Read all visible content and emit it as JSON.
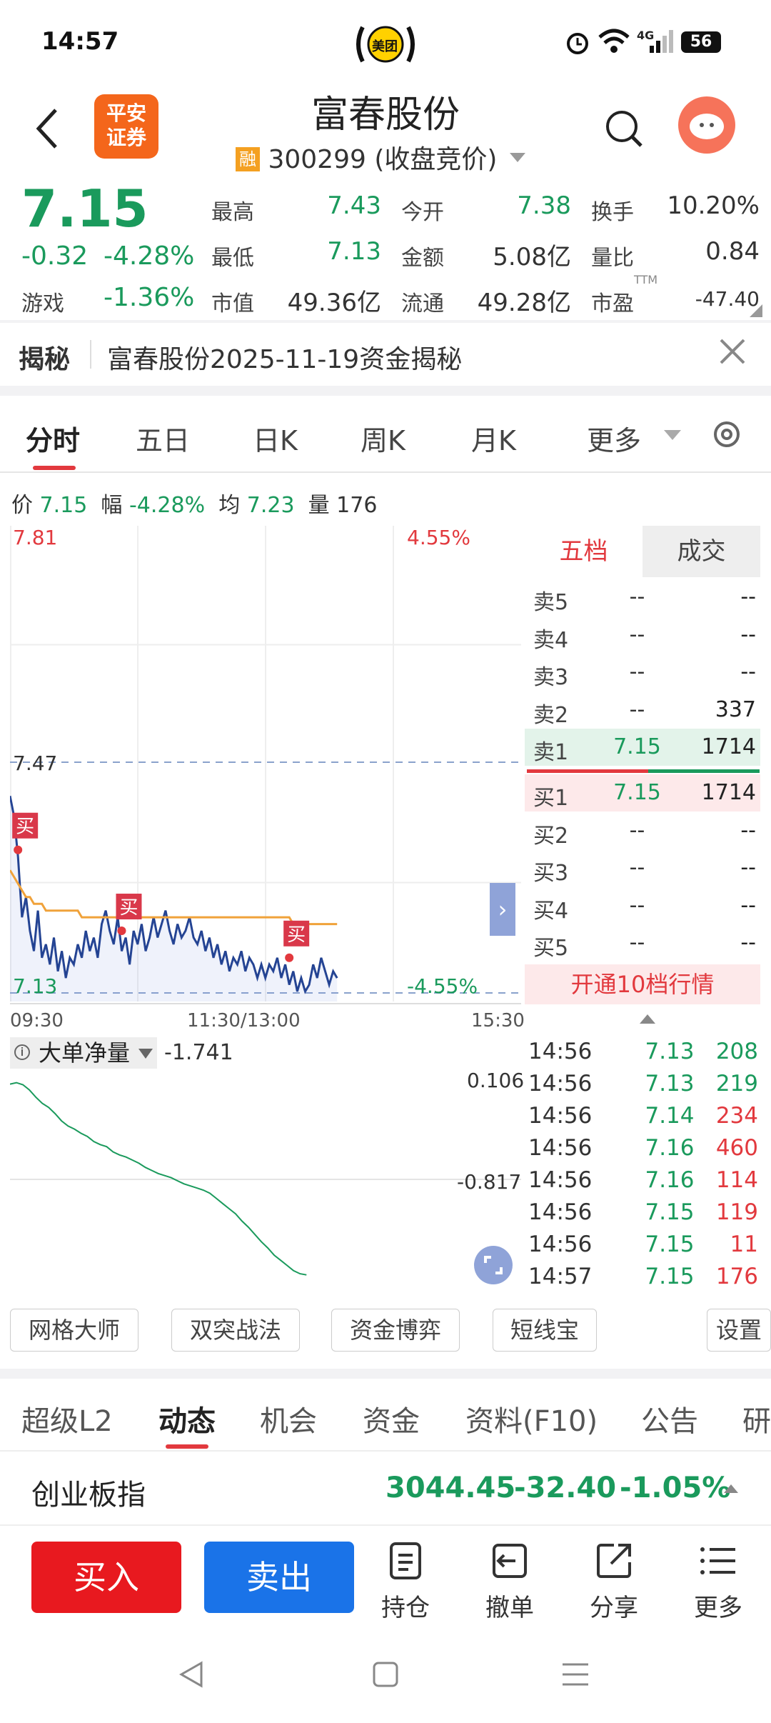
{
  "status_bar": {
    "time": "14:57",
    "center_app": "美团",
    "net": "4G",
    "battery": "56"
  },
  "header": {
    "broker_logo": "平安证券",
    "title": "富春股份",
    "margin_tag": "融",
    "code_line": "300299 (收盘竞价)"
  },
  "quote": {
    "price": "7.15",
    "change": "-0.32",
    "change_pct": "-4.28%",
    "sector_name": "游戏",
    "sector_pct": "-1.36%",
    "cells": [
      {
        "label": "最高",
        "value": "7.43"
      },
      {
        "label": "今开",
        "value": "7.38"
      },
      {
        "label": "换手",
        "value": "10.20%"
      },
      {
        "label": "最低",
        "value": "7.13"
      },
      {
        "label": "金额",
        "value": "5.08亿"
      },
      {
        "label": "量比",
        "value": "0.84"
      },
      {
        "label": "市值",
        "value": "49.36亿"
      },
      {
        "label": "流通",
        "value": "49.28亿"
      },
      {
        "label": "市盈",
        "sup": "TTM",
        "value": "-47.40"
      }
    ]
  },
  "banner": {
    "tag": "揭秘",
    "text": "富春股份2025-11-19资金揭秘"
  },
  "chart_tabs": [
    "分时",
    "五日",
    "日K",
    "周K",
    "月K",
    "更多"
  ],
  "info_line": {
    "price_label": "价",
    "price": "7.15",
    "amp_label": "幅",
    "amp": "-4.28%",
    "avg_label": "均",
    "avg": "7.23",
    "vol_label": "量",
    "vol": "176"
  },
  "chart_data": {
    "type": "line",
    "y_top_label": "7.81",
    "y_top_pct": "4.55%",
    "y_mid_label": "7.47",
    "y_bottom_label": "7.13",
    "y_bottom_pct": "-4.55%",
    "x_labels": [
      "09:30",
      "11:30/13:00",
      "15:30"
    ],
    "buy_marker": "买",
    "price": [
      7.42,
      7.39,
      7.33,
      7.24,
      7.27,
      7.22,
      7.19,
      7.25,
      7.18,
      7.2,
      7.17,
      7.21,
      7.16,
      7.19,
      7.15,
      7.18,
      7.17,
      7.2,
      7.18,
      7.22,
      7.19,
      7.21,
      7.18,
      7.23,
      7.25,
      7.22,
      7.2,
      7.24,
      7.19,
      7.21,
      7.17,
      7.22,
      7.2,
      7.23,
      7.19,
      7.21,
      7.24,
      7.21,
      7.23,
      7.25,
      7.22,
      7.2,
      7.23,
      7.21,
      7.22,
      7.24,
      7.21,
      7.2,
      7.22,
      7.19,
      7.21,
      7.18,
      7.2,
      7.17,
      7.19,
      7.16,
      7.18,
      7.17,
      7.19,
      7.16,
      7.18,
      7.17,
      7.15,
      7.17,
      7.15,
      7.17,
      7.16,
      7.18,
      7.15,
      7.17,
      7.14,
      7.16,
      7.13,
      7.15,
      7.13,
      7.14,
      7.17,
      7.15,
      7.18,
      7.16,
      7.14,
      7.16,
      7.15
    ],
    "avg": [
      7.31,
      7.3,
      7.29,
      7.28,
      7.27,
      7.27,
      7.26,
      7.26,
      7.26,
      7.25,
      7.25,
      7.25,
      7.25,
      7.25,
      7.25,
      7.25,
      7.25,
      7.25,
      7.24,
      7.24,
      7.24,
      7.24,
      7.24,
      7.24,
      7.24,
      7.24,
      7.24,
      7.24,
      7.24,
      7.24,
      7.24,
      7.24,
      7.24,
      7.24,
      7.24,
      7.24,
      7.24,
      7.24,
      7.24,
      7.24,
      7.24,
      7.24,
      7.24,
      7.24,
      7.24,
      7.24,
      7.24,
      7.24,
      7.24,
      7.24,
      7.24,
      7.24,
      7.24,
      7.24,
      7.24,
      7.24,
      7.24,
      7.24,
      7.24,
      7.24,
      7.24,
      7.24,
      7.24,
      7.24,
      7.24,
      7.24,
      7.24,
      7.24,
      7.24,
      7.24,
      7.24,
      7.23,
      7.23,
      7.23,
      7.23,
      7.23,
      7.23,
      7.23,
      7.23,
      7.23,
      7.23,
      7.23,
      7.23
    ],
    "ylim": [
      7.13,
      7.81
    ]
  },
  "orderbook": {
    "tabs": [
      "五档",
      "成交"
    ],
    "asks": [
      {
        "n": "卖5",
        "p": "--",
        "v": "--"
      },
      {
        "n": "卖4",
        "p": "--",
        "v": "--"
      },
      {
        "n": "卖3",
        "p": "--",
        "v": "--"
      },
      {
        "n": "卖2",
        "p": "--",
        "v": "337"
      },
      {
        "n": "卖1",
        "p": "7.15",
        "v": "1714"
      }
    ],
    "bids": [
      {
        "n": "买1",
        "p": "7.15",
        "v": "1714"
      },
      {
        "n": "买2",
        "p": "--",
        "v": "--"
      },
      {
        "n": "买3",
        "p": "--",
        "v": "--"
      },
      {
        "n": "买4",
        "p": "--",
        "v": "--"
      },
      {
        "n": "买5",
        "p": "--",
        "v": "--"
      }
    ],
    "upgrade": "开通10档行情"
  },
  "indicator": {
    "name": "大单净量",
    "value": "-1.741",
    "top": "0.106",
    "mid": "-0.817",
    "series": [
      0.106,
      0.12,
      0.1,
      0.05,
      -0.02,
      -0.08,
      -0.12,
      -0.18,
      -0.25,
      -0.3,
      -0.33,
      -0.37,
      -0.4,
      -0.45,
      -0.48,
      -0.5,
      -0.55,
      -0.58,
      -0.6,
      -0.63,
      -0.66,
      -0.7,
      -0.73,
      -0.76,
      -0.78,
      -0.8,
      -0.83,
      -0.86,
      -0.88,
      -0.9,
      -0.92,
      -0.95,
      -1.0,
      -1.05,
      -1.1,
      -1.15,
      -1.22,
      -1.28,
      -1.35,
      -1.42,
      -1.48,
      -1.55,
      -1.6,
      -1.65,
      -1.7,
      -1.73,
      -1.741
    ]
  },
  "trades": [
    {
      "t": "14:56",
      "p": "7.13",
      "v": "208",
      "c": "g"
    },
    {
      "t": "14:56",
      "p": "7.13",
      "v": "219",
      "c": "g"
    },
    {
      "t": "14:56",
      "p": "7.14",
      "v": "234",
      "c": "r"
    },
    {
      "t": "14:56",
      "p": "7.16",
      "v": "460",
      "c": "r"
    },
    {
      "t": "14:56",
      "p": "7.16",
      "v": "114",
      "c": "r"
    },
    {
      "t": "14:56",
      "p": "7.15",
      "v": "119",
      "c": "r"
    },
    {
      "t": "14:56",
      "p": "7.15",
      "v": "11",
      "c": "r"
    },
    {
      "t": "14:57",
      "p": "7.15",
      "v": "176",
      "c": "r"
    }
  ],
  "tools": [
    "网格大师",
    "双突战法",
    "资金博弈",
    "短线宝",
    "设置"
  ],
  "bottom_tabs": [
    "超级L2",
    "动态",
    "机会",
    "资金",
    "资料(F10)",
    "公告",
    "研"
  ],
  "index": {
    "name": "创业板指",
    "value": "3044.45",
    "change": "-32.40",
    "pct": "-1.05%"
  },
  "actions": {
    "buy": "买入",
    "sell": "卖出",
    "hold": "持仓",
    "cancel": "撤单",
    "share": "分享",
    "more": "更多"
  },
  "colors": {
    "up": "#e2393e",
    "down": "#1a9a5c",
    "buy_btn": "#e8191f",
    "sell_btn": "#1a73e8",
    "accent": "#e2393e"
  }
}
